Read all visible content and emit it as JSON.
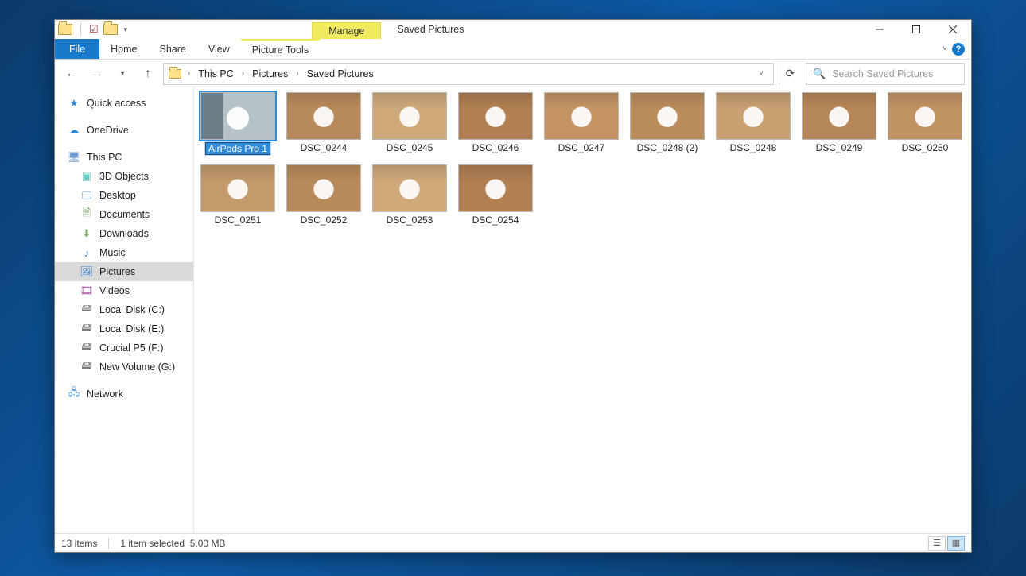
{
  "titlebar": {
    "context_tab": "Manage",
    "title": "Saved Pictures"
  },
  "ribbon": {
    "tabs": {
      "file": "File",
      "home": "Home",
      "share": "Share",
      "view": "View",
      "picture_tools": "Picture Tools"
    }
  },
  "addressbar": {
    "crumbs": [
      "This PC",
      "Pictures",
      "Saved Pictures"
    ]
  },
  "search": {
    "placeholder": "Search Saved Pictures"
  },
  "navpane": {
    "quick_access": "Quick access",
    "onedrive": "OneDrive",
    "this_pc": "This PC",
    "children": {
      "objects3d": "3D Objects",
      "desktop": "Desktop",
      "documents": "Documents",
      "downloads": "Downloads",
      "music": "Music",
      "pictures": "Pictures",
      "videos": "Videos",
      "local_c": "Local Disk (C:)",
      "local_e": "Local Disk (E:)",
      "crucial_f": "Crucial P5 (F:)",
      "newvol_g": "New Volume (G:)"
    },
    "network": "Network"
  },
  "files": [
    {
      "name": "AirPods Pro 1",
      "selected": true,
      "editing": true
    },
    {
      "name": "DSC_0244"
    },
    {
      "name": "DSC_0245"
    },
    {
      "name": "DSC_0246"
    },
    {
      "name": "DSC_0247"
    },
    {
      "name": "DSC_0248 (2)"
    },
    {
      "name": "DSC_0248"
    },
    {
      "name": "DSC_0249"
    },
    {
      "name": "DSC_0250"
    },
    {
      "name": "DSC_0251"
    },
    {
      "name": "DSC_0252"
    },
    {
      "name": "DSC_0253"
    },
    {
      "name": "DSC_0254"
    }
  ],
  "status": {
    "count": "13 items",
    "selection": "1 item selected",
    "size": "5.00 MB"
  }
}
